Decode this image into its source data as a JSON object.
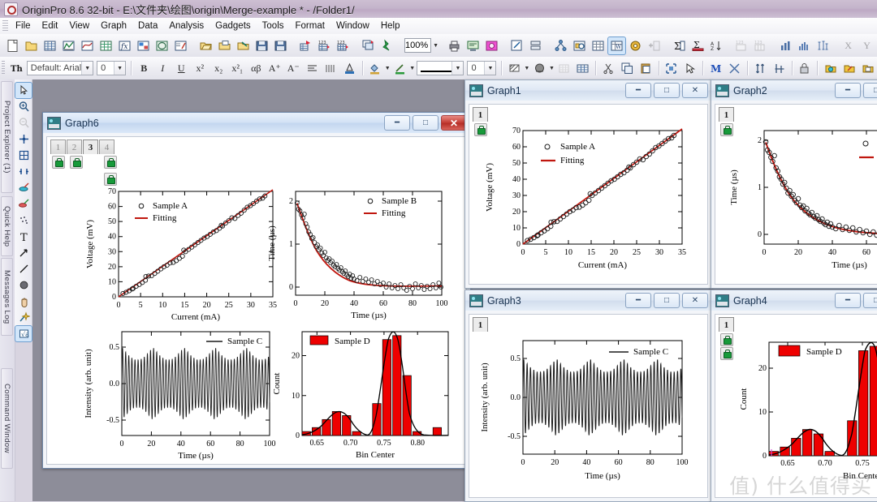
{
  "window": {
    "title": "OriginPro 8.6 32-bit - E:\\文件夹\\绘图\\origin\\Merge-example * - /Folder1/",
    "app_icon": "origin-icon"
  },
  "menubar": {
    "items": [
      "File",
      "Edit",
      "View",
      "Graph",
      "Data",
      "Analysis",
      "Gadgets",
      "Tools",
      "Format",
      "Window",
      "Help"
    ]
  },
  "toolbar": {
    "zoom_value": "100%",
    "font_value": "Default: Arial",
    "font_size_value": "0",
    "line_width_value": "0",
    "text_buttons": [
      "B",
      "I",
      "U",
      "x²",
      "x₂",
      "x²₁",
      "αβ",
      "A⁺",
      "A⁻"
    ]
  },
  "left_dock": {
    "tabs": [
      "Project Explorer  (1)",
      "Quick Help",
      "Messages Log",
      "Command Window"
    ]
  },
  "tools": {
    "items": [
      "pointer-icon",
      "zoom-in-icon",
      "zoom-out-icon",
      "crosshair-icon",
      "scale-icon",
      "data-reader-icon",
      "screen-reader-icon",
      "data-selector-icon",
      "mask-icon",
      "text-tool-icon",
      "arrow-tool-icon",
      "line-tool-icon",
      "ellipse-tool-icon",
      "pan-tool-icon",
      "magic-wand-icon",
      "math-tool-icon"
    ]
  },
  "windows": [
    {
      "id": "graph6",
      "title": "Graph6",
      "active": true,
      "layer_tabs": [
        {
          "label": "1",
          "active": false
        },
        {
          "label": "2",
          "active": false
        },
        {
          "label": "3",
          "active": true
        },
        {
          "label": "4",
          "active": false
        }
      ],
      "buttons": {
        "minimize": "minimize-button",
        "maximize": "maximize-button",
        "close": "close-button"
      },
      "controls": [
        "minimize",
        "maximize",
        "close"
      ]
    },
    {
      "id": "graph1",
      "title": "Graph1",
      "active": false,
      "layer_tabs": [
        {
          "label": "1",
          "active": true
        }
      ],
      "controls": [
        "minimize",
        "maximize",
        "close"
      ]
    },
    {
      "id": "graph2",
      "title": "Graph2",
      "active": false,
      "layer_tabs": [
        {
          "label": "1",
          "active": true
        }
      ],
      "controls": [
        "minimize",
        "maximize",
        "close"
      ]
    },
    {
      "id": "graph3",
      "title": "Graph3",
      "active": false,
      "layer_tabs": [
        {
          "label": "1",
          "active": true
        }
      ],
      "controls": [
        "minimize",
        "maximize",
        "close"
      ]
    },
    {
      "id": "graph4",
      "title": "Graph4",
      "active": false,
      "layer_tabs": [
        {
          "label": "1",
          "active": true
        }
      ],
      "controls": [
        "minimize",
        "maximize",
        "close"
      ]
    }
  ],
  "watermark": "值) 什么值得买",
  "colors": {
    "fit_line_red": "#c0170f",
    "bar_red": "#ee0000",
    "data_black": "#1a1a1a",
    "title_purple": "#c4b4cb",
    "window_caption_blue": "#d3e2f5"
  },
  "chart_data": [
    {
      "id": "sampleA",
      "type": "scatter",
      "title": "",
      "xlabel": "Current (mA)",
      "ylabel": "Voltage (mV)",
      "xlim": [
        0,
        35
      ],
      "ylim": [
        0,
        70
      ],
      "xticks": [
        0,
        5,
        10,
        15,
        20,
        25,
        30,
        35
      ],
      "yticks": [
        0,
        10,
        20,
        30,
        40,
        50,
        60,
        70
      ],
      "legend": [
        "Sample A",
        "Fitting"
      ],
      "legend_position": "top-left",
      "grid": false,
      "series": [
        {
          "name": "Sample A",
          "marker": "open-circle",
          "color": "#1a1a1a",
          "x": [
            1.0,
            1.7,
            2.4,
            3.1,
            3.3,
            4.0,
            4.7,
            5.4,
            6.1,
            6.2,
            6.8,
            7.5,
            8.2,
            8.9,
            9.6,
            10.3,
            11.0,
            11.7,
            12.4,
            13.1,
            13.8,
            14.5,
            14.8,
            15.2,
            15.9,
            16.6,
            17.3,
            18.0,
            18.7,
            19.4,
            20.1,
            20.8,
            21.5,
            22.2,
            22.9,
            23.3,
            23.6,
            24.3,
            25.0,
            25.7,
            26.4,
            27.1,
            27.8,
            28.5,
            29.2,
            29.9,
            30.6,
            31.3,
            32.0,
            32.7,
            33.2
          ],
          "y": [
            2.2,
            3.0,
            4.0,
            5.2,
            5.6,
            7.0,
            8.2,
            9.5,
            11.0,
            13.5,
            13.8,
            14.0,
            15.5,
            17.0,
            18.5,
            20.0,
            21.0,
            22.5,
            22.8,
            24.0,
            25.5,
            27.0,
            31.0,
            30.0,
            31.5,
            33.0,
            34.5,
            36.0,
            37.5,
            39.0,
            40.0,
            41.5,
            43.0,
            44.0,
            45.5,
            47.5,
            47.0,
            49.0,
            50.5,
            52.5,
            52.0,
            54.0,
            55.5,
            57.5,
            59.5,
            60.5,
            62.0,
            63.5,
            65.0,
            65.5,
            67.0
          ]
        },
        {
          "name": "Fitting",
          "type": "line",
          "color": "#c0170f",
          "slope": 2.0,
          "intercept": 0.0
        }
      ]
    },
    {
      "id": "sampleB",
      "type": "scatter",
      "title": "",
      "xlabel": "Time (µs)",
      "ylabel": "Time (µs)",
      "xlim": [
        0,
        100
      ],
      "ylim": [
        -0.15,
        2.2
      ],
      "xticks": [
        0,
        20,
        40,
        60,
        80,
        100
      ],
      "yticks": [
        0,
        1,
        2
      ],
      "legend": [
        "Sample B",
        "Fitting"
      ],
      "legend_position": "top-right",
      "grid": false,
      "series": [
        {
          "name": "Sample B",
          "marker": "open-circle",
          "color": "#1a1a1a",
          "model": "exponential-decay",
          "amplitude": 1.95,
          "tau": 18.0,
          "noise": 0.07
        },
        {
          "name": "Fitting",
          "type": "line",
          "color": "#c0170f",
          "model": "exponential-decay",
          "amplitude": 1.95,
          "tau": 18.0
        }
      ]
    },
    {
      "id": "sampleC",
      "type": "line",
      "title": "",
      "xlabel": "Time (µs)",
      "ylabel": "Intensity (arb. unit)",
      "xlim": [
        0,
        100
      ],
      "ylim": [
        -0.62,
        0.62
      ],
      "xticks": [
        0,
        20,
        40,
        60,
        80,
        100
      ],
      "yticks": [
        -0.5,
        0.0,
        0.5
      ],
      "ytick_labels": [
        "-0.5",
        "0.0",
        "0.5"
      ],
      "legend": [
        "Sample C"
      ],
      "legend_position": "top-right",
      "grid": false,
      "series": [
        {
          "name": "Sample C",
          "type": "line",
          "color": "#1a1a1a",
          "model": "beat-oscillation",
          "carrier_period": 2.1,
          "envelope_period": 21.0,
          "amplitude": 0.5,
          "envelope_depth": 0.35
        }
      ]
    },
    {
      "id": "sampleD",
      "type": "bar",
      "title": "",
      "xlabel": "Bin Center",
      "ylabel": "Count",
      "xlim": [
        0.627,
        0.845
      ],
      "ylim": [
        0,
        26
      ],
      "xticks": [
        0.65,
        0.7,
        0.75,
        0.8
      ],
      "xtick_labels": [
        "0.65",
        "0.70",
        "0.75",
        "0.80"
      ],
      "yticks": [
        0,
        10,
        20
      ],
      "legend": [
        "Sample D"
      ],
      "legend_position": "top-left",
      "grid": false,
      "bin_centers": [
        0.633,
        0.648,
        0.663,
        0.678,
        0.693,
        0.708,
        0.723,
        0.738,
        0.753,
        0.768,
        0.783,
        0.798,
        0.813,
        0.838
      ],
      "values": [
        1,
        2,
        4,
        6,
        5,
        1,
        0,
        8,
        24,
        25,
        15,
        1,
        0,
        2
      ],
      "bar_color": "#ee0000",
      "bar_edge_color": "#000000",
      "fit_curve": {
        "name": "bimodal-gaussian-fit",
        "color": "#000000",
        "peaks": [
          {
            "center": 0.69,
            "height": 6,
            "sigma": 0.018
          },
          {
            "center": 0.776,
            "height": 25.5,
            "sigma": 0.0125
          }
        ]
      }
    }
  ]
}
